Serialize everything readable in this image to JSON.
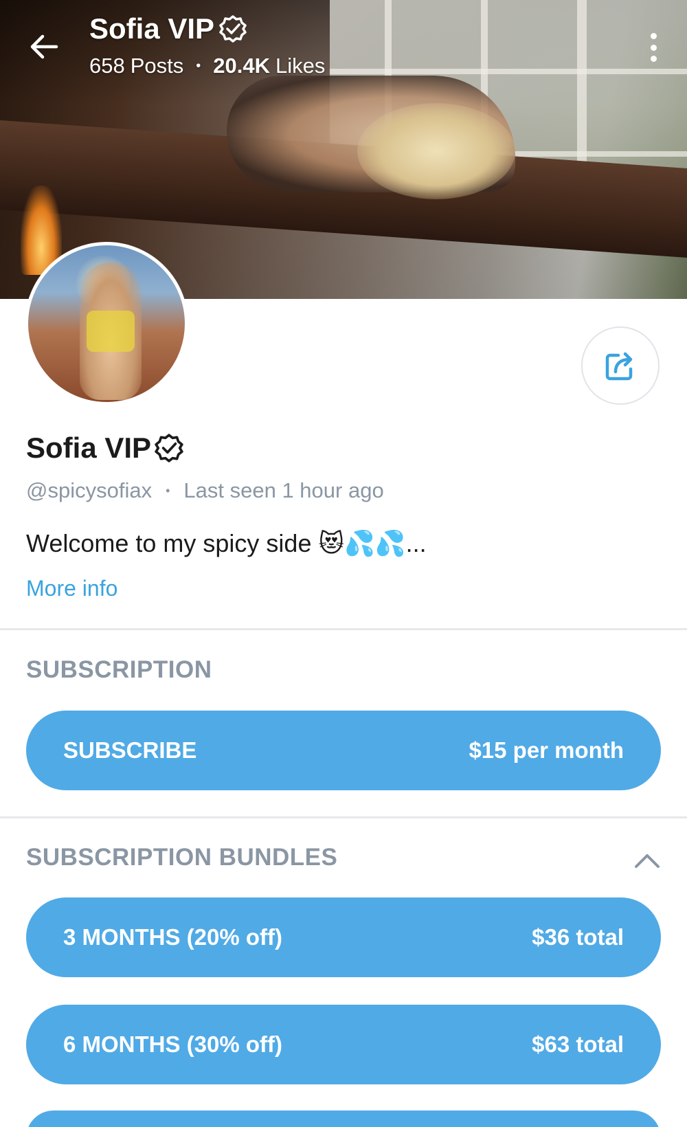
{
  "header": {
    "name": "Sofia VIP",
    "posts_count": "658",
    "posts_label": "Posts",
    "likes_count": "20.4K",
    "likes_label": "Likes"
  },
  "profile": {
    "name": "Sofia VIP",
    "handle": "@spicysofiax",
    "last_seen": "Last seen 1 hour ago",
    "bio": "Welcome to my spicy side 😻💦💦...",
    "more_info": "More info"
  },
  "subscription": {
    "title": "SUBSCRIPTION",
    "button_label": "SUBSCRIBE",
    "price": "$15 per month"
  },
  "bundles": {
    "title": "SUBSCRIPTION BUNDLES",
    "items": [
      {
        "label": "3 MONTHS (20% off)",
        "price": "$36 total"
      },
      {
        "label": "6 MONTHS (30% off)",
        "price": "$63 total"
      }
    ]
  },
  "colors": {
    "accent": "#50aae6",
    "link": "#3aa3de",
    "muted": "#8a96a3"
  },
  "icons": [
    "back-arrow-icon",
    "verified-badge-icon",
    "more-vertical-icon",
    "share-icon",
    "chevron-up-icon"
  ]
}
